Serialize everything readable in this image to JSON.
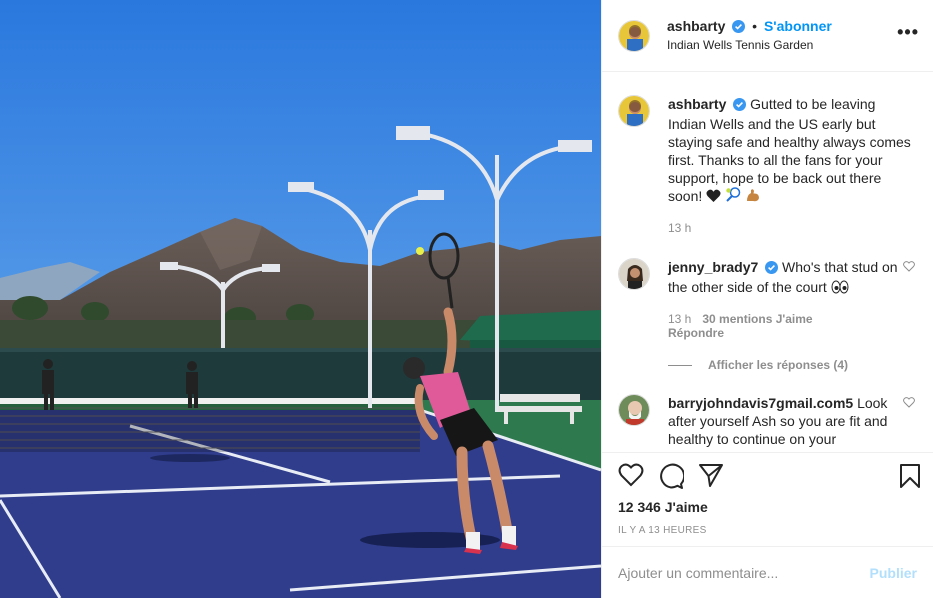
{
  "post": {
    "author": "ashbarty",
    "follow_label": "S'abonner",
    "location": "Indian Wells Tennis Garden",
    "more_label": "•••"
  },
  "caption": {
    "username": "ashbarty",
    "text": "Gutted to be leaving Indian Wells and the US early but staying safe and healthy always comes first. Thanks to all the fans for your support, hope to be back out there soon!",
    "emojis": [
      "black-heart",
      "tennis",
      "flexed-biceps"
    ],
    "time": "13 h"
  },
  "comments": [
    {
      "username": "jenny_brady7",
      "verified": true,
      "text": "Who's that stud on the other side of the court",
      "emoji": "eyes",
      "time": "13 h",
      "likes": "30 mentions J'aime",
      "reply_label": "Répondre",
      "view_replies": "Afficher les réponses (4)"
    },
    {
      "username": "barryjohndavis7gmail.com5",
      "verified": false,
      "text": "Look after yourself Ash so you are fit and healthy to continue on your"
    }
  ],
  "actions": {
    "likes_count": "12 346 J'aime",
    "timestamp": "IL Y A 13 HEURES",
    "comment_placeholder": "Ajouter un commentaire...",
    "publish_label": "Publier"
  },
  "colors": {
    "accent": "#0095f6",
    "publish_disabled": "#b2dffc",
    "muted": "#8e8e8e",
    "court_blue": "#2f3d8c",
    "sky": "#3f8fe6"
  }
}
